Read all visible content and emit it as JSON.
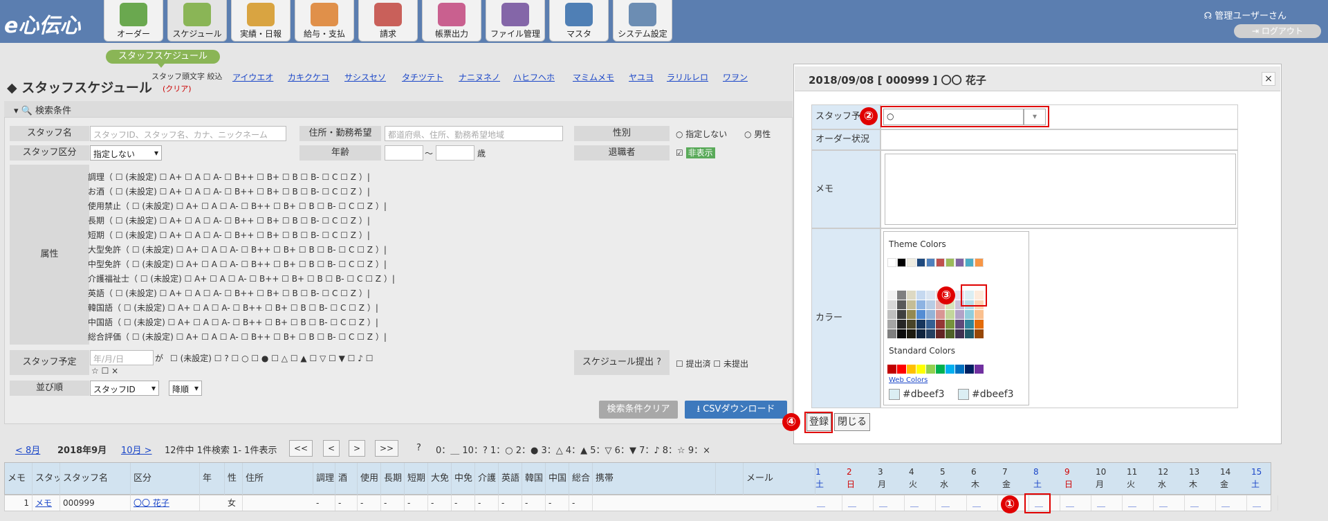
{
  "app": {
    "logo": "e心伝心"
  },
  "nav": [
    {
      "label": "オーダー",
      "color": "#6aa84f"
    },
    {
      "label": "スケジュール",
      "color": "#8ab556"
    },
    {
      "label": "実績・日報",
      "color": "#d9a441"
    },
    {
      "label": "給与・支払",
      "color": "#e0904a"
    },
    {
      "label": "請求",
      "color": "#c9605a"
    },
    {
      "label": "帳票出力",
      "color": "#c9608f"
    },
    {
      "label": "ファイル管理",
      "color": "#8466a8"
    },
    {
      "label": "マスタ",
      "color": "#4f7fb5"
    },
    {
      "label": "システム設定",
      "color": "#6c8db3"
    }
  ],
  "user": {
    "name": "管理ユーザーさん",
    "logout": "ログアウト"
  },
  "subnav": {
    "active": "スタッフスケジュール"
  },
  "page": {
    "title": "スタッフスケジュール",
    "kana_label": "スタッフ頭文字 絞込",
    "kana_clear": "(クリア)",
    "kana": [
      "アイウエオ",
      "カキクケコ",
      "サシスセソ",
      "タチツテト",
      "ナニヌネノ",
      "ハヒフヘホ",
      "マミムメモ",
      "ヤユヨ",
      "ラリルレロ",
      "ワヲン"
    ]
  },
  "search": {
    "header": "検索条件",
    "staff_name_label": "スタッフ名",
    "staff_name_ph": "スタッフID、スタッフ名、カナ、ニックネーム",
    "addr_label": "住所・勤務希望",
    "addr_ph": "都道府県、住所、勤務希望地域",
    "gender_label": "性別",
    "gender_opts": [
      "指定しない",
      "男性"
    ],
    "class_label": "スタッフ区分",
    "class_value": "指定しない",
    "age_label": "年齢",
    "age_sep": "〜",
    "age_unit": "歳",
    "retired_label": "退職者",
    "retired_value": "非表示",
    "attr_label": "属性",
    "attributes": [
      "調理（ ☐ (未設定)   ☐ A+   ☐ A   ☐ A-   ☐ B++   ☐ B+   ☐ B   ☐ B-   ☐ C   ☐ Z  ）|",
      "お酒（ ☐ (未設定)   ☐ A+   ☐ A   ☐ A-   ☐ B++   ☐ B+   ☐ B   ☐ B-   ☐ C   ☐ Z  ）|",
      "使用禁止（ ☐ (未設定)   ☐ A+   ☐ A   ☐ A-   ☐ B++   ☐ B+   ☐ B   ☐ B-   ☐ C   ☐ Z  ）|",
      "長期（ ☐ (未設定)   ☐ A+   ☐ A   ☐ A-   ☐ B++   ☐ B+   ☐ B   ☐ B-   ☐ C   ☐ Z  ）|",
      "短期（ ☐ (未設定)   ☐ A+   ☐ A   ☐ A-   ☐ B++   ☐ B+   ☐ B   ☐ B-   ☐ C   ☐ Z  ）|",
      "大型免許（ ☐ (未設定)   ☐ A+   ☐ A   ☐ A-   ☐ B++   ☐ B+   ☐ B   ☐ B-   ☐ C   ☐ Z  ）|",
      "中型免許（ ☐ (未設定)   ☐ A+   ☐ A   ☐ A-   ☐ B++   ☐ B+   ☐ B   ☐ B-   ☐ C   ☐ Z  ）|",
      "介護福祉士（ ☐ (未設定)   ☐ A+   ☐ A   ☐ A-   ☐ B++   ☐ B+   ☐ B   ☐ B-   ☐ C   ☐ Z  ）|",
      "英語（ ☐ (未設定)   ☐ A+   ☐ A   ☐ A-   ☐ B++   ☐ B+   ☐ B   ☐ B-   ☐ C   ☐ Z  ）|",
      "韓国語（ ☐ (未設定)   ☐ A+   ☐ A   ☐ A-   ☐ B++   ☐ B+   ☐ B   ☐ B-   ☐ C   ☐ Z  ）|",
      "中国語（ ☐ (未設定)   ☐ A+   ☐ A   ☐ A-   ☐ B++   ☐ B+   ☐ B   ☐ B-   ☐ C   ☐ Z  ）|",
      "総合評価（ ☐ (未設定)   ☐ A+   ☐ A   ☐ A-   ☐ B++   ☐ B+   ☐ B   ☐ B-   ☐ C   ☐ Z  ）|"
    ],
    "plan_label": "スタッフ予定",
    "plan_date_ph": "年/月/日",
    "plan_ga": "が",
    "plan_opts": "☐ (未設定)    ☐ ?    ☐ ○    ☐ ●    ☐ △    ☐ ▲    ☐ ▽    ☐ ▼    ☐ ♪    ☐",
    "plan_opts2": "☆    ☐ ×",
    "submit_label": "スケジュール提出",
    "submit_opts": "☐ 提出済    ☐ 未提出",
    "sort_label": "並び順",
    "sort_value": "スタッフID",
    "sort_order": "降順",
    "clear_btn": "検索条件クリア",
    "csv_btn": "CSVダウンロード"
  },
  "pager": {
    "prev": "< 8月",
    "current": "2018年9月",
    "next": "10月 >",
    "summary": "12件中 1件検索 1- 1件表示",
    "btns": [
      "<<",
      "<",
      ">",
      ">>"
    ],
    "legend": "0：＿    10：?    1：○    2：●    3：△    4：▲    5：▽    6：▼    7：♪    8：☆    9：×"
  },
  "table": {
    "headers": [
      "メモ",
      "スタッフID",
      "スタッフ名",
      "区分",
      "年",
      "性",
      "住所",
      "調理",
      "酒",
      "使用",
      "長期",
      "短期",
      "大免",
      "中免",
      "介護",
      "英語",
      "韓国",
      "中国",
      "総合",
      "携帯",
      "",
      "メール"
    ],
    "days": [
      {
        "n": "1",
        "w": "土",
        "c": "#1a46c8"
      },
      {
        "n": "2",
        "w": "日",
        "c": "#d00000"
      },
      {
        "n": "3",
        "w": "月",
        "c": "#333333"
      },
      {
        "n": "4",
        "w": "火",
        "c": "#333333"
      },
      {
        "n": "5",
        "w": "水",
        "c": "#333333"
      },
      {
        "n": "6",
        "w": "木",
        "c": "#333333"
      },
      {
        "n": "7",
        "w": "金",
        "c": "#333333"
      },
      {
        "n": "8",
        "w": "土",
        "c": "#1a46c8"
      },
      {
        "n": "9",
        "w": "日",
        "c": "#d00000"
      },
      {
        "n": "10",
        "w": "月",
        "c": "#333333"
      },
      {
        "n": "11",
        "w": "火",
        "c": "#333333"
      },
      {
        "n": "12",
        "w": "水",
        "c": "#333333"
      },
      {
        "n": "13",
        "w": "木",
        "c": "#333333"
      },
      {
        "n": "14",
        "w": "金",
        "c": "#333333"
      },
      {
        "n": "15",
        "w": "土",
        "c": "#1a46c8"
      }
    ],
    "row": {
      "no": "1",
      "memo": "メモ",
      "id": "000999",
      "name": "〇〇 花子",
      "gender": "女",
      "dash": "-",
      "cell": "＿"
    }
  },
  "modal": {
    "title": "2018/09/08 [ 000999 ] 〇〇 花子",
    "close": "×",
    "plan_label": "スタッフ予定",
    "plan_value": "○",
    "order_label": "オーダー状況",
    "memo_label": "メモ",
    "color_label": "カラー",
    "theme_colors": "Theme Colors",
    "standard_colors": "Standard Colors",
    "web_colors": "Web Colors",
    "color_value1": "#dbeef3",
    "color_value2": "#dbeef3",
    "register_btn": "登録",
    "close_btn": "閉じる"
  },
  "markers": [
    "①",
    "②",
    "③",
    "④"
  ]
}
